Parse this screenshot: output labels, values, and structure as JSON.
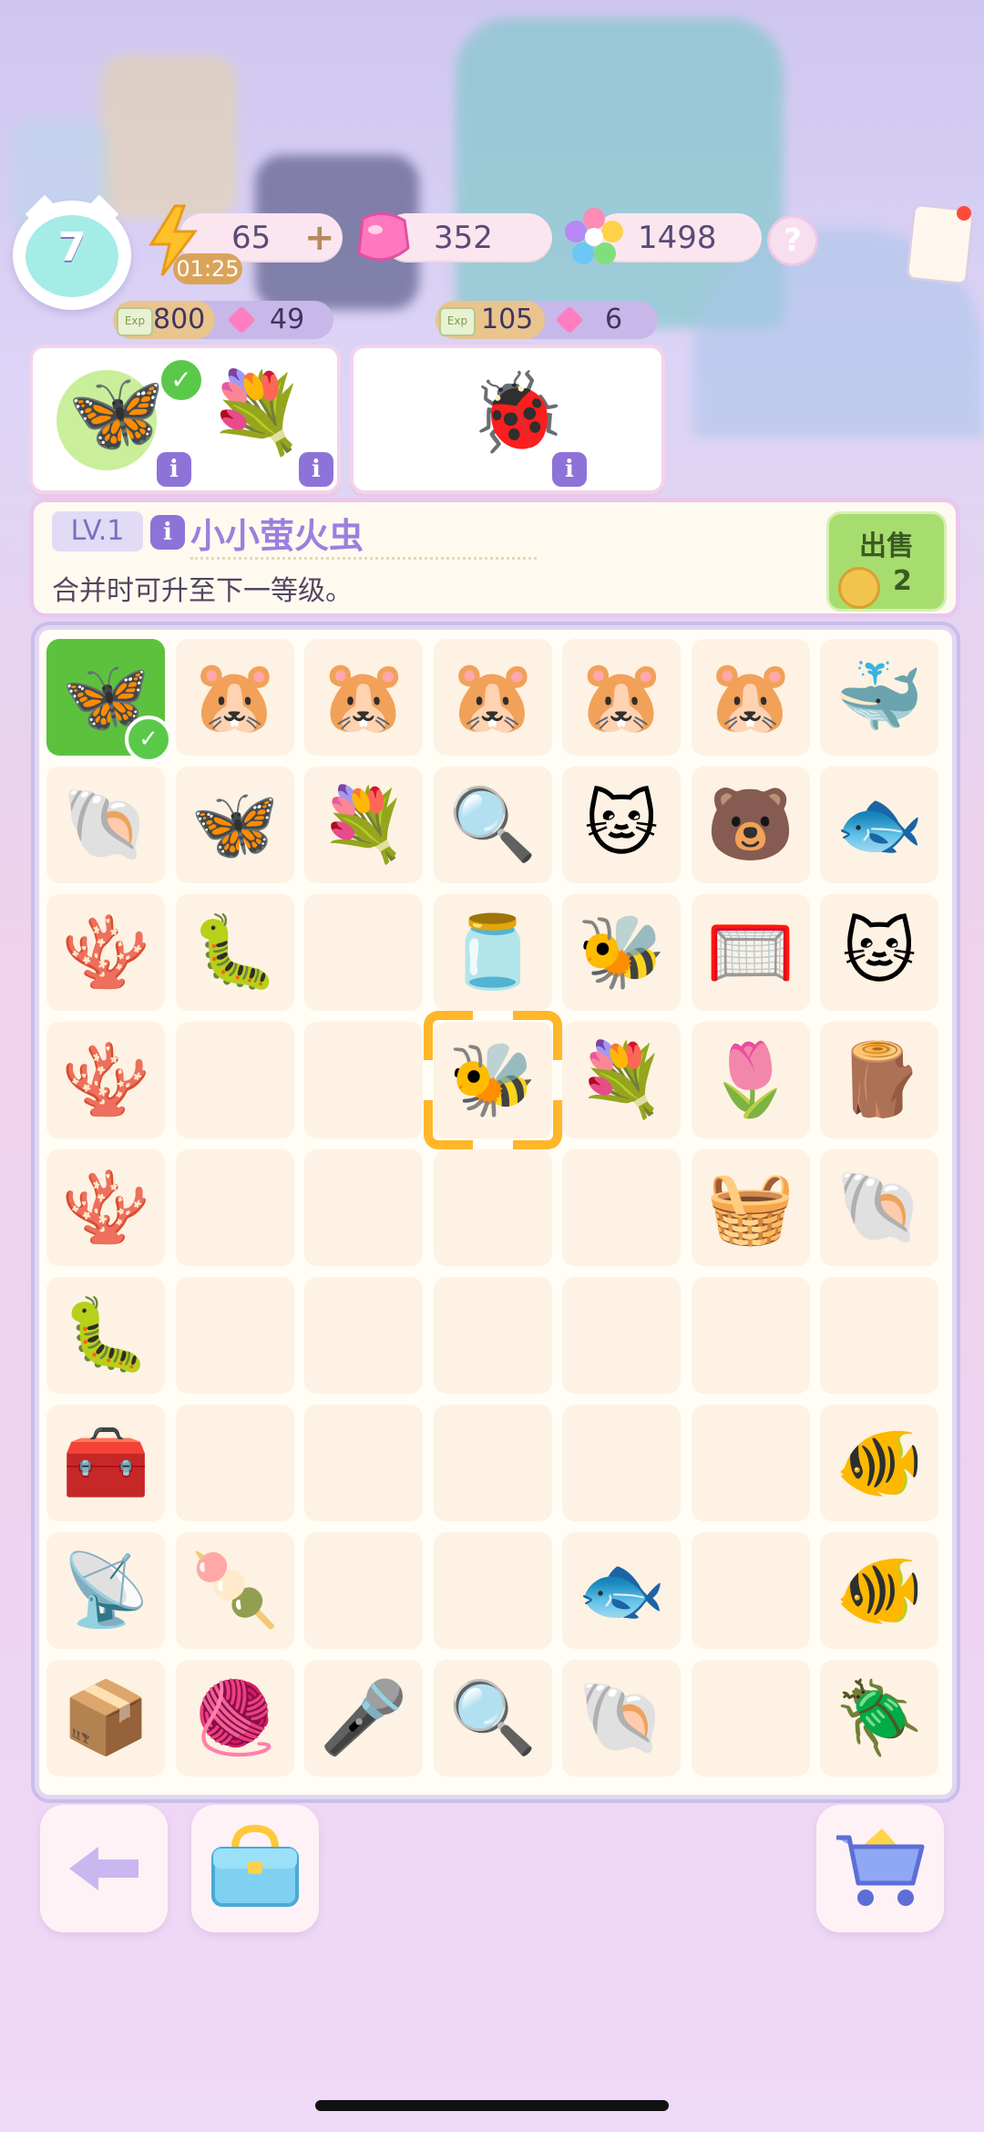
{
  "hud": {
    "level": "7",
    "energy": {
      "value": "65",
      "plus": "+",
      "timer": "01:25"
    },
    "gems": "352",
    "flowers": "1498",
    "help": "?"
  },
  "orders": [
    {
      "exp": "800",
      "gems": "49",
      "items": [
        "butterfly-icon",
        "flower-vase-icon"
      ]
    },
    {
      "exp": "105",
      "gems": "6",
      "items": [
        "ladybug-icon"
      ]
    }
  ],
  "info_panel": {
    "level": "LV.1",
    "info": "i",
    "name": "小小萤火虫",
    "description": "合并时可升至下一等级。",
    "sell_label": "出售",
    "sell_price": "2"
  },
  "labels": {
    "exp": "Exp"
  },
  "board": {
    "cols": 7,
    "rows": 9,
    "cells": [
      [
        "🦋",
        "🐹",
        "🐹",
        "🐹",
        "🐹",
        "🐹",
        "🐳"
      ],
      [
        "🐚",
        "🦋",
        "💐",
        "🔍",
        "🐱",
        "🐻",
        "🐟"
      ],
      [
        "🪸",
        "🐛",
        "",
        "🫙",
        "🐝",
        "🥅",
        "🐱"
      ],
      [
        "🪸",
        "",
        "",
        "🐝",
        "💐",
        "🌷",
        "🪵"
      ],
      [
        "🪸",
        "",
        "",
        "",
        "",
        "🧺",
        "🐚"
      ],
      [
        "🐛",
        "",
        "",
        "",
        "",
        "",
        ""
      ],
      [
        "🧰",
        "",
        "",
        "",
        "",
        "",
        "🐠"
      ],
      [
        "📡",
        "🍡",
        "",
        "",
        "🐟",
        "",
        "🐠"
      ],
      [
        "📦",
        "🧶",
        "🎤",
        "🔍",
        "🐚",
        "",
        "🪲"
      ]
    ]
  },
  "bottom": {
    "back": "back-arrow-icon",
    "bag": "inventory-box-icon",
    "shop": "shopping-cart-icon"
  }
}
